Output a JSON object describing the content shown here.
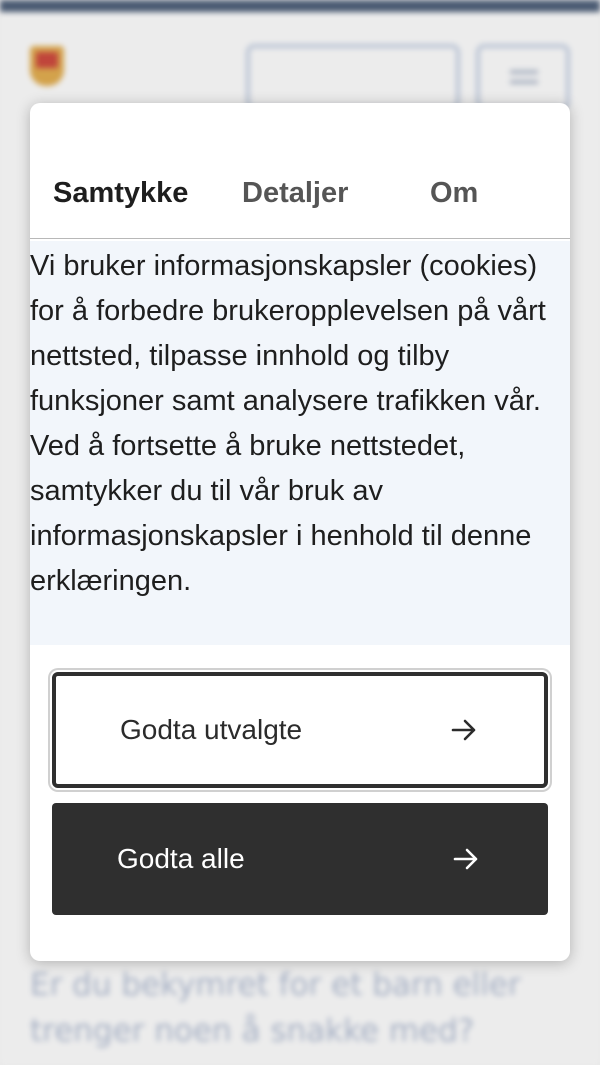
{
  "background": {
    "question_text": "Er du bekymret for et barn eller trenger noen å snakke med?"
  },
  "consent_dialog": {
    "tabs": [
      {
        "label": "Samtykke",
        "active": true
      },
      {
        "label": "Detaljer",
        "active": false
      },
      {
        "label": "Om",
        "active": false
      }
    ],
    "body_text": "Vi bruker informasjonskapsler (cookies) for å forbedre brukeropplevelsen på vårt nettsted, tilpasse innhold og tilby funksjoner samt analysere trafikken vår. Ved å fortsette å bruke nettstedet, samtykker du til vår bruk av informasjonskapsler i henhold til denne erklæringen.",
    "buttons": {
      "accept_selected": "Godta utvalgte",
      "accept_all": "Godta alle"
    }
  },
  "colors": {
    "dark": "#2f2f2f",
    "text_panel_bg": "#f2f6fb",
    "top_bar": "#4a5a72"
  },
  "icons": {
    "button_arrow": "arrow-right-icon"
  }
}
